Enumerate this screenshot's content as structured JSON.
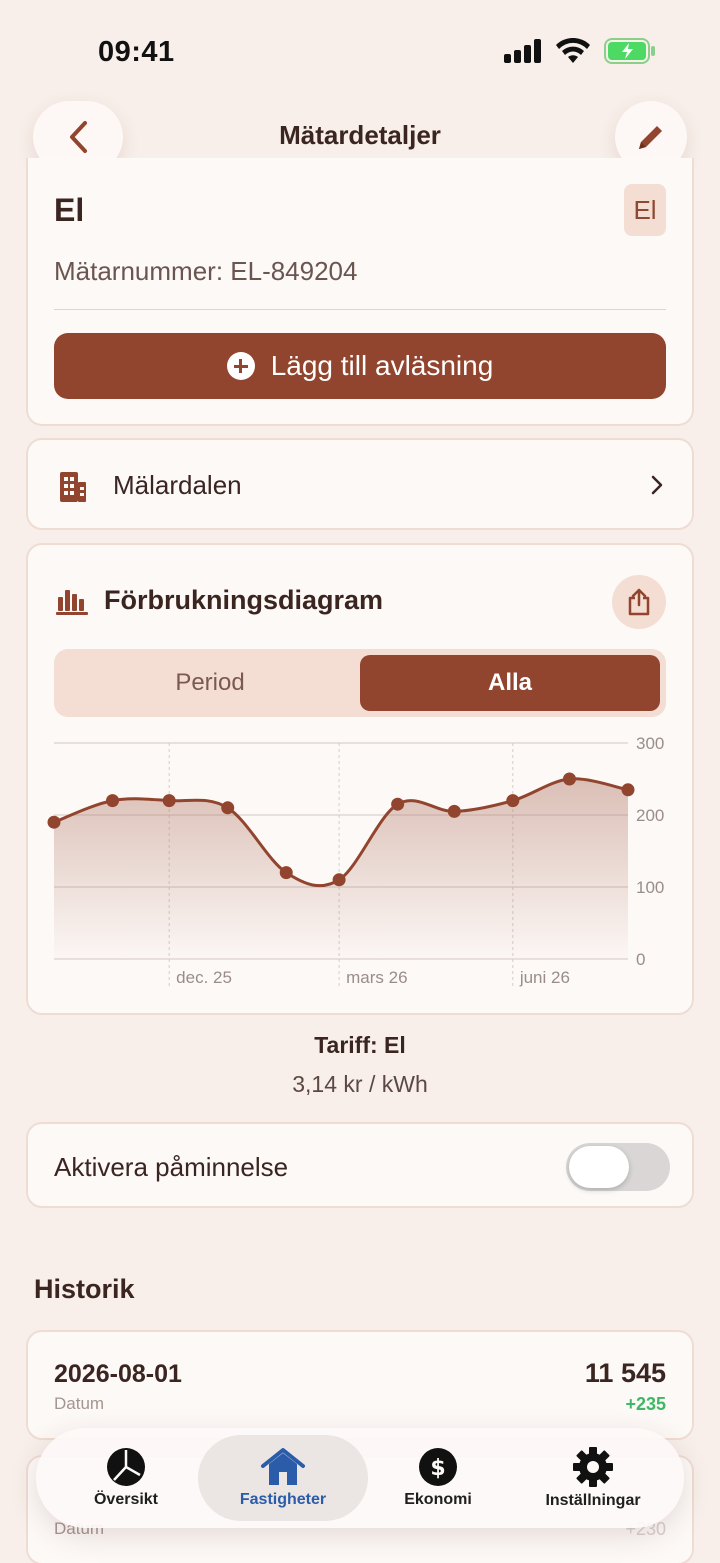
{
  "status": {
    "time": "09:41"
  },
  "header": {
    "title": "Mätardetaljer"
  },
  "meter": {
    "name": "El",
    "badge": "El",
    "number": "Mätarnummer: EL-849204",
    "add_reading_label": "Lägg till avläsning"
  },
  "property": {
    "name": "Mälardalen"
  },
  "chart_section": {
    "title": "Förbrukningsdiagram",
    "segments": [
      "Period",
      "Alla"
    ],
    "selected_segment": "Alla"
  },
  "chart_data": {
    "type": "area",
    "x": [
      "2025-10-01",
      "2025-11-01",
      "2025-12-01",
      "2026-01-01",
      "2026-02-01",
      "2026-03-01",
      "2026-04-01",
      "2026-05-01",
      "2026-06-01",
      "2026-07-01",
      "2026-08-01"
    ],
    "values": [
      190,
      220,
      220,
      210,
      120,
      110,
      215,
      205,
      220,
      250,
      235
    ],
    "x_tick_labels": [
      "dec. 25",
      "mars 26",
      "juni 26"
    ],
    "y_tick_labels": [
      "300",
      "200",
      "100",
      "0"
    ],
    "ylim": [
      0,
      300
    ],
    "grid": true,
    "color": "#92452e"
  },
  "tariff": {
    "title": "Tariff: El",
    "price": "3,14 kr / kWh"
  },
  "reminder": {
    "label": "Aktivera påminnelse",
    "enabled": false
  },
  "history": {
    "title": "Historik",
    "entries": [
      {
        "date": "2026-08-01",
        "date_label": "Datum",
        "value": "11 545",
        "delta": "+235"
      },
      {
        "date": "",
        "date_label": "Datum",
        "value": "",
        "delta": "+230"
      }
    ]
  },
  "tabs": [
    {
      "label": "Översikt",
      "icon": "pie-chart-icon",
      "active": false
    },
    {
      "label": "Fastigheter",
      "icon": "house-icon",
      "active": true
    },
    {
      "label": "Ekonomi",
      "icon": "dollar-icon",
      "active": false
    },
    {
      "label": "Inställningar",
      "icon": "gear-icon",
      "active": false
    }
  ],
  "colors": {
    "accent": "#92452e",
    "background": "#f8efea",
    "positive": "#3fb866",
    "tab_active": "#2a5caa"
  }
}
